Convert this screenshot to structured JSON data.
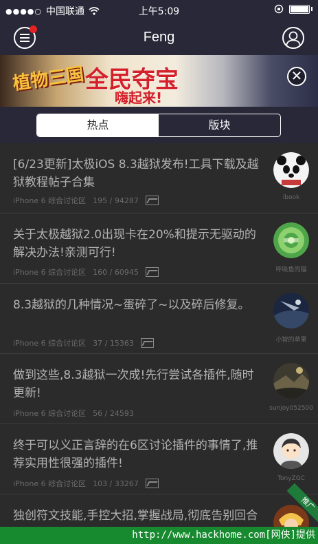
{
  "status_bar": {
    "carrier": "中国联通",
    "time": "上午5:09"
  },
  "nav": {
    "title": "Feng"
  },
  "banner": {
    "logo": "植物三国",
    "headline": "全民夺宝",
    "subline": "嗨起来!",
    "close": "✕"
  },
  "tabs": [
    {
      "label": "热点",
      "active": true
    },
    {
      "label": "版块",
      "active": false
    }
  ],
  "posts": [
    {
      "title": "[6/23更新]太极iOS 8.3越狱发布!工具下载及越狱教程帖子合集",
      "forum": "iPhone 6 综合讨论区",
      "stats": "195 / 94287",
      "user": "ibook",
      "avatar_icon": "panda-avatar-icon"
    },
    {
      "title": "关于太极越狱2.0出现卡在20%和提示无驱动的解决办法!亲测可行!",
      "forum": "iPhone 6 综合讨论区",
      "stats": "160 / 60945",
      "user": "呼吸鱼的猫",
      "avatar_icon": "green-pattern-avatar-icon"
    },
    {
      "title": "8.3越狱的几种情况~蛋碎了~以及碎后修复。",
      "forum": "iPhone 6 综合讨论区",
      "stats": "37 / 15363",
      "user": "小智的苹果",
      "avatar_icon": "dark-photo-avatar-icon"
    },
    {
      "title": "做到这些,8.3越狱一次成!先行尝试各插件,随时更新!",
      "forum": "iPhone 6 综合讨论区",
      "stats": "56 / 24593",
      "user": "sunjoy052500",
      "avatar_icon": "landscape-avatar-icon"
    },
    {
      "title": "终于可以义正言辞的在6区讨论插件的事情了,推荐实用性很强的插件!",
      "forum": "iPhone 6 综合讨论区",
      "stats": "103 / 33267",
      "user": "TonyZGC",
      "avatar_icon": "default-person-avatar-icon"
    },
    {
      "title": "独创符文技能,手控大招,掌握战局,彻底告别回合模式",
      "forum": "",
      "stats": "",
      "user": "",
      "avatar_icon": "game-character-avatar-icon",
      "badge": "推广"
    }
  ],
  "footer": {
    "text": "http://www.hackhome.com[网侠]提供"
  }
}
